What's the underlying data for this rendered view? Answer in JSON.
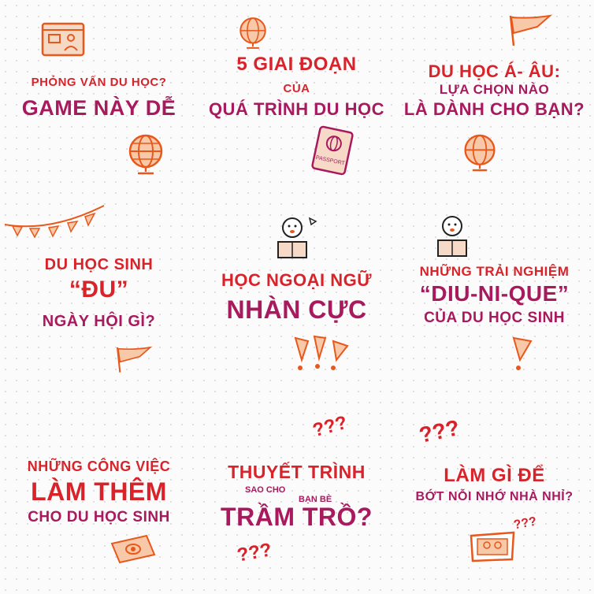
{
  "colors": {
    "red": "#d8232a",
    "purple": "#a8195d",
    "orange": "#e8581c",
    "background": "#fbfbfb"
  },
  "tiles": [
    {
      "lines": [
        "PHỎNG VẤN DU HỌC?",
        "GAME NÀY DỄ"
      ],
      "icons": [
        "presentation-board-icon",
        "globe-icon"
      ]
    },
    {
      "lines": [
        "5 GIAI ĐOẠN",
        "CỦA",
        "QUÁ TRÌNH DU HỌC"
      ],
      "icons": [
        "globe-icon",
        "passport-icon"
      ],
      "passport_text": "PASSPORT"
    },
    {
      "lines": [
        "DU HỌC Á- ÂU:",
        "LỰA CHỌN NÀO",
        "LÀ DÀNH CHO BẠN?"
      ],
      "icons": [
        "flag-icon",
        "globe-icon"
      ]
    },
    {
      "lines": [
        "DU HỌC SINH",
        "“ĐU”",
        "NGÀY HỘI GÌ?"
      ],
      "icons": [
        "bunting-icon",
        "flag-icon"
      ]
    },
    {
      "lines": [
        "HỌC NGOẠI NGỮ",
        "NHÀN CỰC"
      ],
      "icons": [
        "reading-student-icon",
        "exclamation-icon"
      ]
    },
    {
      "lines": [
        "NHỮNG TRẢI NGHIỆM",
        "“DIU-NI-QUE”",
        "CỦA DU HỌC SINH"
      ],
      "icons": [
        "reading-student-icon",
        "exclamation-icon"
      ]
    },
    {
      "lines": [
        "NHỮNG CÔNG VIỆC",
        "LÀM THÊM",
        "CHO DU HỌC SINH"
      ],
      "icons": [
        "banknote-icon"
      ]
    },
    {
      "lines": [
        "THUYẾT TRÌNH",
        "SAO CHO",
        "BẠN BÈ",
        "TRẦM TRỒ?"
      ],
      "icons": [
        "question-marks-icon"
      ],
      "qmarks": "???"
    },
    {
      "lines": [
        "LÀM GÌ ĐỂ",
        "BỚT NỖI NHỚ NHÀ NHỈ?"
      ],
      "icons": [
        "question-marks-icon",
        "photo-frame-icon"
      ],
      "qmarks": "???"
    }
  ]
}
